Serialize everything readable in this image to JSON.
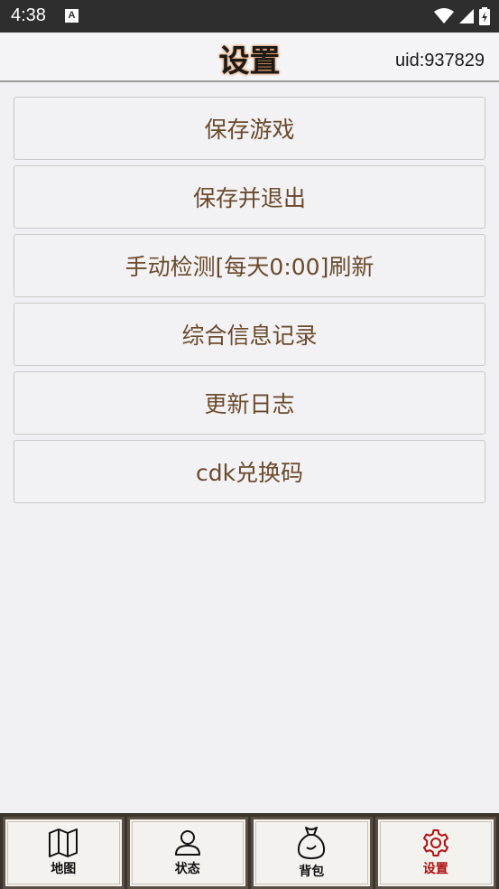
{
  "status_bar": {
    "time": "4:38",
    "notification_icon": "a-letter-icon"
  },
  "header": {
    "title": "设置",
    "uid": "uid:937829"
  },
  "menu": {
    "items": [
      {
        "label": "保存游戏"
      },
      {
        "label": "保存并退出"
      },
      {
        "label": "手动检测[每天0:00]刷新"
      },
      {
        "label": "综合信息记录"
      },
      {
        "label": "更新日志"
      },
      {
        "label": "cdk兑换码"
      }
    ]
  },
  "tabbar": {
    "tabs": [
      {
        "label": "地图",
        "icon": "map-icon"
      },
      {
        "label": "状态",
        "icon": "person-icon"
      },
      {
        "label": "背包",
        "icon": "bag-icon"
      },
      {
        "label": "设置",
        "icon": "gear-icon",
        "active": true
      }
    ],
    "active_color": "#b01010"
  }
}
